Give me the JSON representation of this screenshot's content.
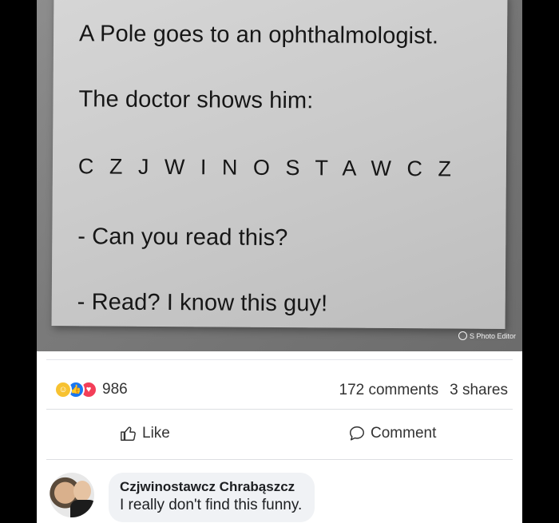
{
  "post": {
    "photo_lines": [
      "A Pole goes to an ophthalmologist.",
      "The doctor shows him:",
      "C Z J W I N O S T A W C Z",
      "- Can you read this?",
      "- Read? I know this guy!"
    ],
    "watermark": "S Photo Editor"
  },
  "stats": {
    "reaction_count": "986",
    "comments": "172 comments",
    "shares": "3 shares",
    "reaction_icons": [
      "haha",
      "like",
      "love"
    ]
  },
  "actions": {
    "like_label": "Like",
    "comment_label": "Comment"
  },
  "comment": {
    "author": "Czjwinostawcz Chrabąszcz",
    "text": "I really don't find this funny."
  },
  "colors": {
    "like_blue": "#1877f2",
    "love_red": "#f33e58",
    "haha_yellow": "#f7c231"
  }
}
